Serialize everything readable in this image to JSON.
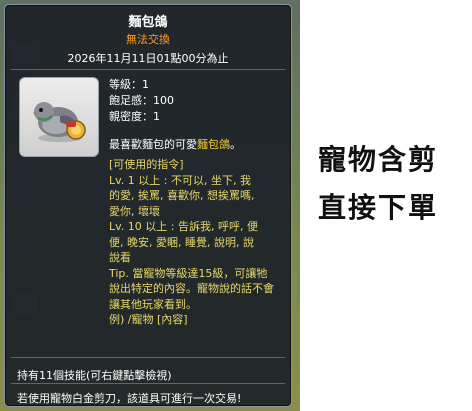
{
  "tooltip": {
    "title": "麵包鴿",
    "trade_status": "無法交換",
    "expiry": "2026年11月11日01點00分為止",
    "stats": {
      "level": "等級：1",
      "fullness": "飽足感：100",
      "intimacy": "親密度：1"
    },
    "description_prefix": "最喜歡麵包的可愛",
    "description_highlight": "麵包鴿",
    "description_suffix": "。",
    "commands_header": "[可使用的指令]",
    "commands": [
      "Lv. 1 以上 : 不可以, 坐下, 我",
      "的愛, 挨罵, 喜歡你, 想挨罵嗎,",
      "愛你, 壞壞",
      "Lv. 10 以上 : 告訴我, 呼呼, 便",
      "便, 晚安, 愛睏, 睡覺, 說明, 說",
      "說看",
      "Tip. 當寵物等級達15級，可讓牠",
      "說出特定的內容。寵物說的話不會",
      "讓其他玩家看到。",
      "例) /寵物 [內容]"
    ],
    "skills_text": "持有11個技能(可右鍵點擊檢視)",
    "footer_text": "若使用寵物白金剪刀，該道具可進行一次交易!"
  },
  "side_text": {
    "line1": "寵物含剪",
    "line2": "直接下單"
  },
  "colors": {
    "panel_bg": "#1c2128",
    "title": "#ffffff",
    "trade_status": "#ff9a2a",
    "highlight": "#ffcf3a",
    "commands": "#e8d76a"
  },
  "icons": {
    "pet": "bread-pigeon-icon"
  }
}
